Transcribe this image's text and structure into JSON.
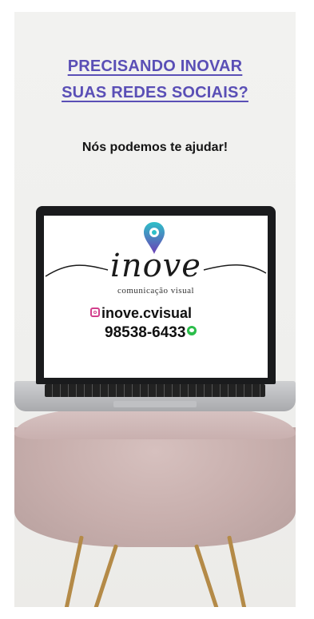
{
  "headline": [
    "PRECISANDO INOVAR",
    "SUAS REDES SOCIAIS?"
  ],
  "subline": "Nós podemos te ajudar!",
  "logo": {
    "wordmark": "inove",
    "tagline": "comunicação visual"
  },
  "contact": {
    "instagram_handle": "inove.cvisual",
    "phone": "98538-6433",
    "instagram_icon": "instagram-icon",
    "whatsapp_icon": "whatsapp-icon"
  },
  "colors": {
    "headline": "#5a4fb6",
    "pin_top": "#2ec0c8",
    "pin_bottom": "#6b3fb6",
    "whatsapp": "#2bbd4a",
    "instagram": "#d23f8c"
  }
}
